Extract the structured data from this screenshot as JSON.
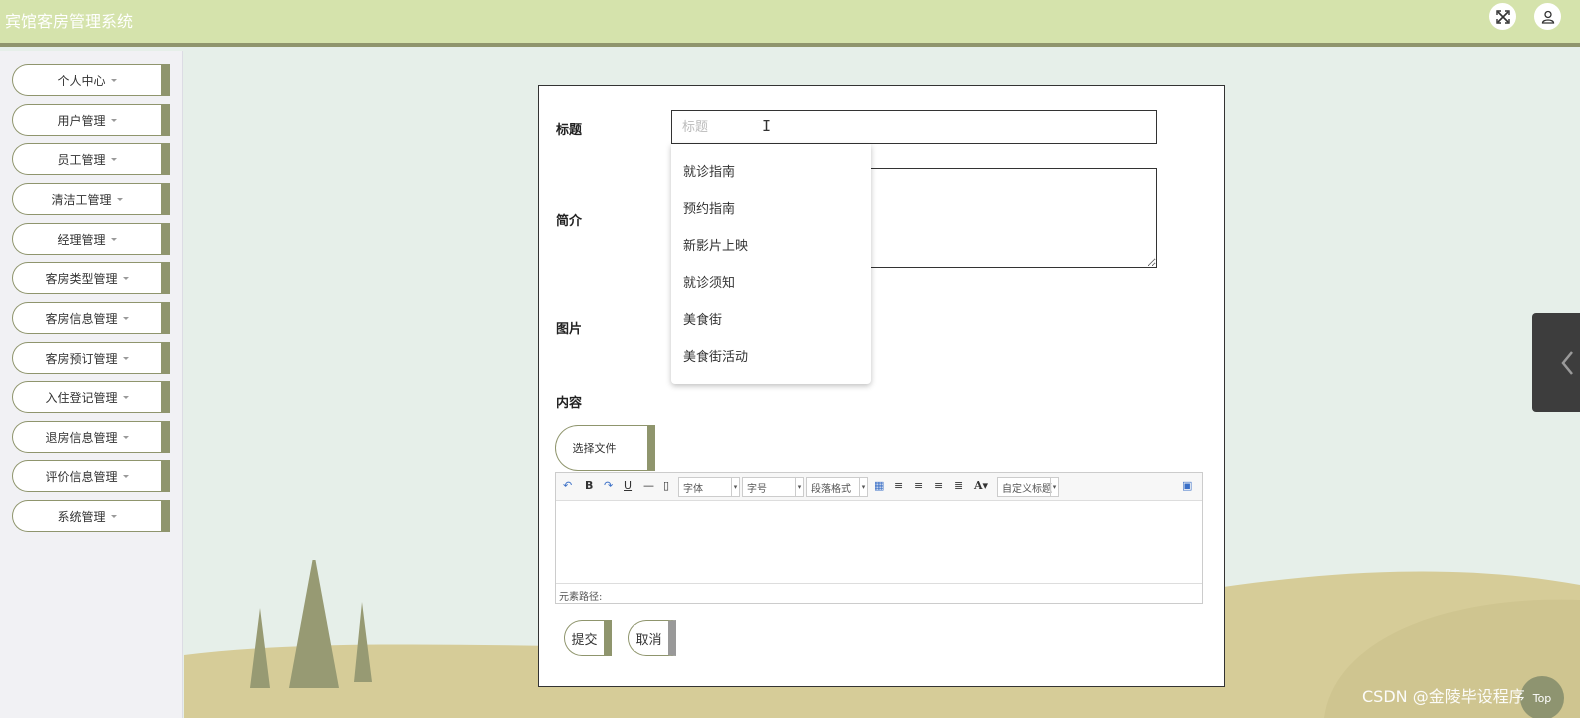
{
  "header": {
    "app_title": "宾馆客房管理系统",
    "fullscreen_icon": "expand-icon",
    "user_icon": "user-icon"
  },
  "sidebar": {
    "items": [
      {
        "label": "个人中心"
      },
      {
        "label": "用户管理"
      },
      {
        "label": "员工管理"
      },
      {
        "label": "清洁工管理"
      },
      {
        "label": "经理管理"
      },
      {
        "label": "客房类型管理"
      },
      {
        "label": "客房信息管理"
      },
      {
        "label": "客房预订管理"
      },
      {
        "label": "入住登记管理"
      },
      {
        "label": "退房信息管理"
      },
      {
        "label": "评价信息管理"
      },
      {
        "label": "系统管理"
      }
    ]
  },
  "form": {
    "title_label": "标题",
    "title_placeholder": "标题",
    "title_value": "",
    "summary_label": "简介",
    "image_label": "图片",
    "content_label": "内容",
    "file_button": "选择文件",
    "submit_button": "提交",
    "cancel_button": "取消"
  },
  "autocomplete": {
    "options": [
      "就诊指南",
      "预约指南",
      "新影片上映",
      "就诊须知",
      "美食街",
      "美食街活动"
    ]
  },
  "editor": {
    "font_family_select": "字体",
    "font_size_select": "字号",
    "paragraph_select": "段落格式",
    "custom_title_select": "自定义标题",
    "status_path": "元素路径:"
  },
  "overlay": {
    "watermark": "CSDN @金陵毕设程序",
    "top_button": "Top"
  },
  "colors": {
    "header_bg": "#d5e3ac",
    "accent": "#8f956d",
    "content_bg": "#e6efe9"
  }
}
